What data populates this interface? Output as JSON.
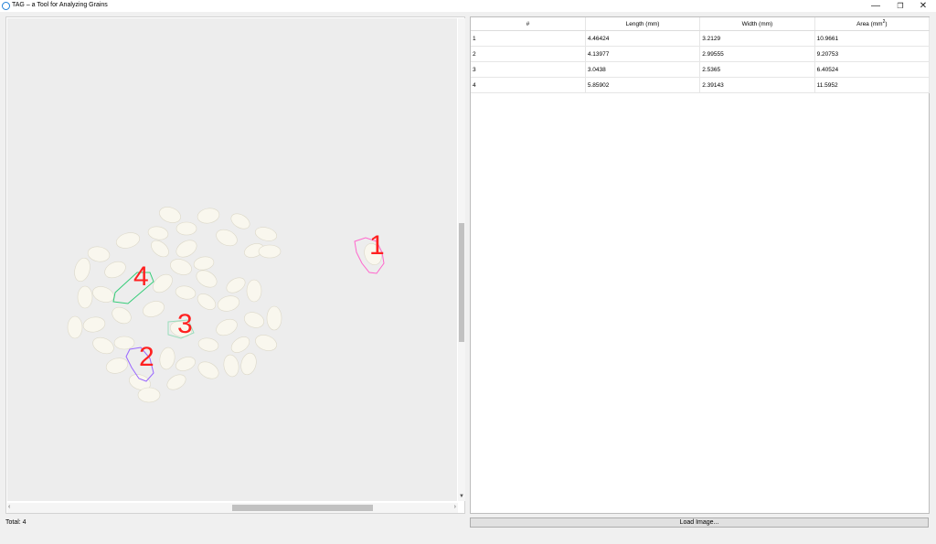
{
  "window": {
    "title": "TAG – a Tool for Analyzing Grains",
    "minimize": "—",
    "maximize": "❐",
    "close": "✕"
  },
  "table": {
    "headers": [
      "#",
      "Length (mm)",
      "Width (mm)",
      "Area (mm"
    ],
    "area_unit_sup": "2",
    "area_close": ")",
    "rows": [
      [
        "1",
        "4.46424",
        "3.2129",
        "10.9661"
      ],
      [
        "2",
        "4.13977",
        "2.99555",
        "9.20753"
      ],
      [
        "3",
        "3.0438",
        "2.5365",
        "6.40524"
      ],
      [
        "4",
        "5.85902",
        "2.39143",
        "11.5952"
      ]
    ]
  },
  "image": {
    "labels": [
      "1",
      "2",
      "3",
      "4"
    ],
    "colors": {
      "label": "#ff2020",
      "grain1": "#ff66cc",
      "grain2": "#9966ff",
      "grain3": "#99ddbb",
      "grain4": "#33cc77"
    }
  },
  "status": {
    "total": "Total: 4"
  },
  "buttons": {
    "load_image": "Load Image..."
  }
}
